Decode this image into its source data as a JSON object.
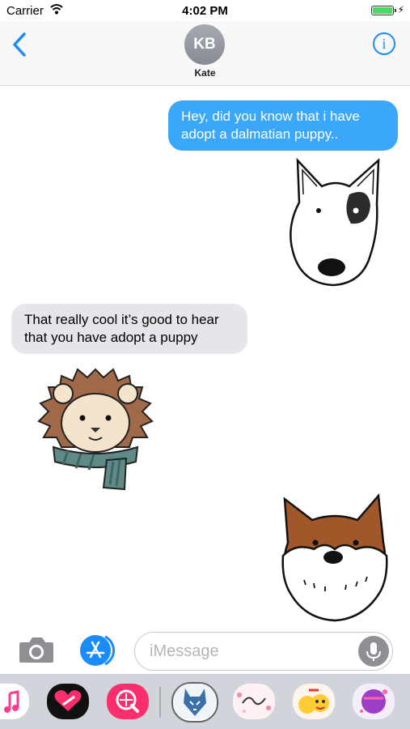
{
  "status_bar": {
    "carrier": "Carrier",
    "time": "4:02 PM"
  },
  "header": {
    "avatar_initials": "KB",
    "contact_name": "Kate"
  },
  "messages": [
    {
      "direction": "outgoing",
      "text": "Hey, did you know that i have adopt a dalmatian puppy.."
    },
    {
      "direction": "incoming",
      "text": "That really cool it’s good to hear that you have adopt a puppy"
    }
  ],
  "compose": {
    "placeholder": "iMessage"
  },
  "icons": [
    "wifi-icon",
    "battery-icon",
    "back-chevron-icon",
    "info-icon",
    "camera-icon",
    "app-store-icon",
    "microphone-icon",
    "music-icon",
    "heart-icon",
    "search-globe-icon",
    "wolf-sticker-icon",
    "beautiful-day-sticker-icon",
    "emoji-sticker-icon",
    "cool-dude-sticker-icon"
  ],
  "colors": {
    "accent": "#1b8cf7",
    "outgoing_bubble": "#3aa7fb",
    "incoming_bubble": "#e5e5ea",
    "drawer": "#d1d4da"
  }
}
